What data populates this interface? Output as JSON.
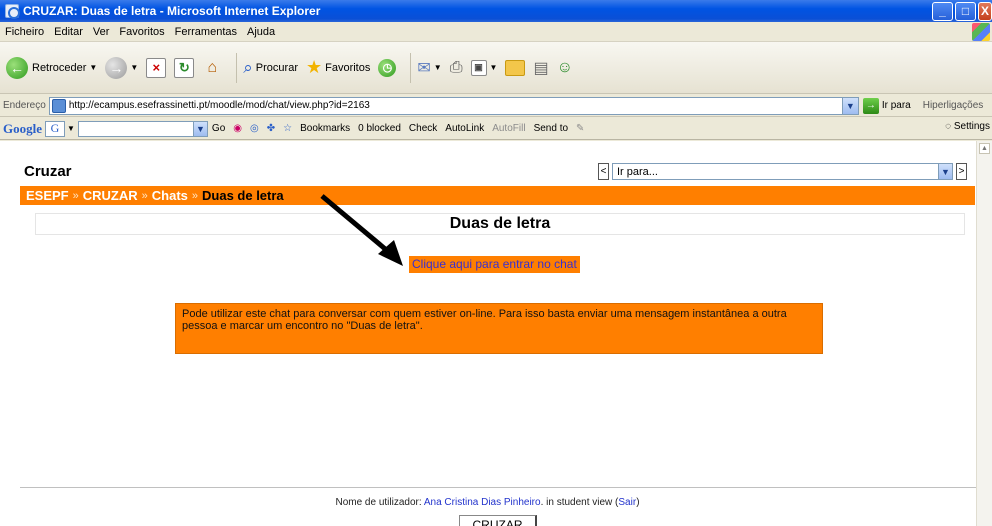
{
  "window": {
    "title": "CRUZAR: Duas de letra - Microsoft Internet Explorer"
  },
  "menu": {
    "items": [
      "Ficheiro",
      "Editar",
      "Ver",
      "Favoritos",
      "Ferramentas",
      "Ajuda"
    ]
  },
  "toolbar": {
    "back": "Retroceder",
    "search": "Procurar",
    "favorites": "Favoritos"
  },
  "address": {
    "label": "Endereço",
    "url": "http://ecampus.esefrassinetti.pt/moodle/mod/chat/view.php?id=2163",
    "go": "Ir para",
    "links": "Hiperligações"
  },
  "google": {
    "logo": "Google",
    "box": "G",
    "go": "Go",
    "bookmarks": "Bookmarks",
    "blocked": "0 blocked",
    "check": "Check",
    "autolink": "AutoLink",
    "autofill": "AutoFill",
    "sendto": "Send to",
    "settings": "Settings"
  },
  "page": {
    "course": "Cruzar",
    "jump": {
      "prev": "<",
      "next": ">",
      "selected": "Ir para..."
    },
    "breadcrumb": [
      "ESEPF",
      "CRUZAR",
      "Chats",
      "Duas de letra"
    ],
    "breadcrumb_sep": "»",
    "heading": "Duas de letra",
    "chat_link": "Clique aqui para entrar no chat",
    "notice": "Pode utilizar este chat para conversar com quem estiver on-line. Para isso basta enviar uma mensagem instantânea a outra pessoa e marcar um encontro no \"Duas de letra\".",
    "footer": {
      "prefix": "Nome de utilizador:",
      "user": "Ana Cristina Dias Pinheiro",
      "suffix": ". in student view (",
      "logout": "Sair",
      "end": ")"
    },
    "home_button": "CRUZAR"
  }
}
